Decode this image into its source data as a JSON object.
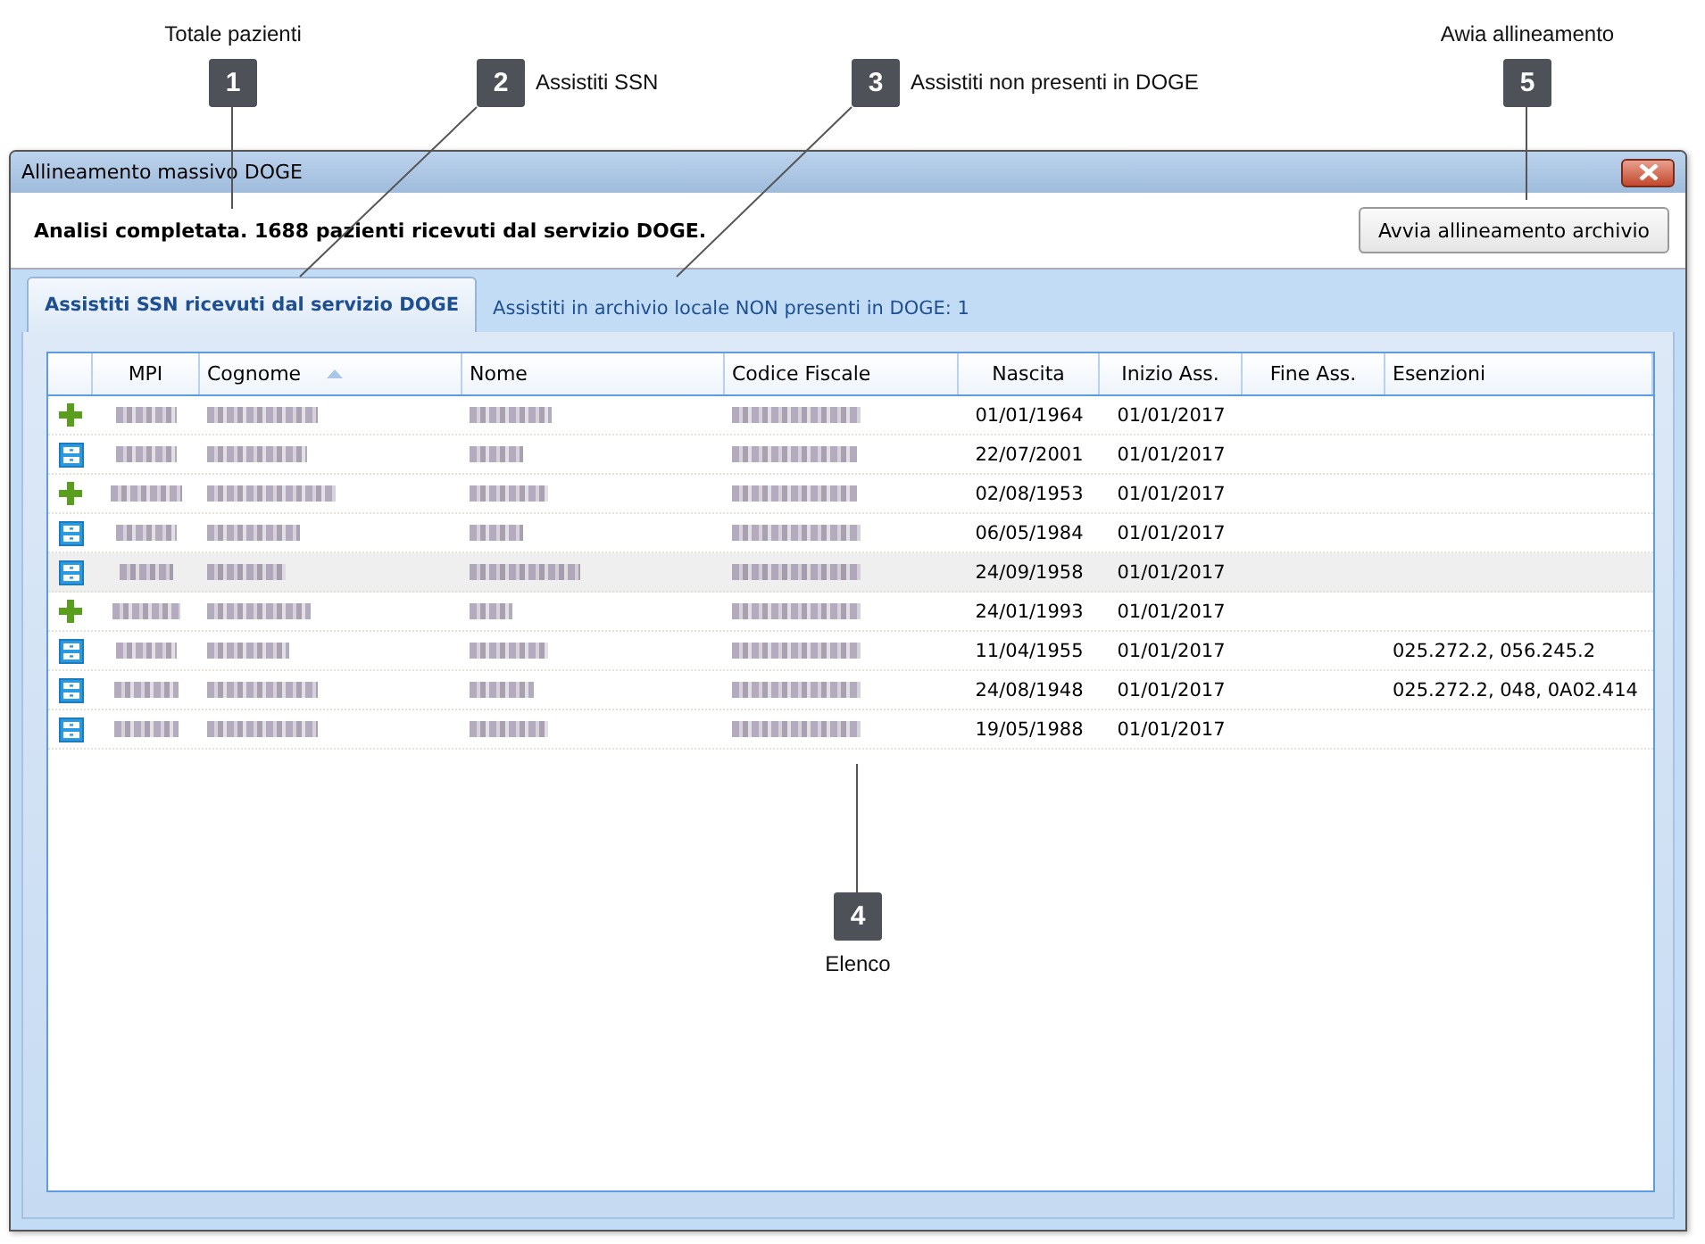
{
  "callouts": [
    {
      "number": "1",
      "label": "Totale pazienti"
    },
    {
      "number": "2",
      "label": "Assistiti SSN"
    },
    {
      "number": "3",
      "label": "Assistiti non presenti in DOGE"
    },
    {
      "number": "4",
      "label": "Elenco"
    },
    {
      "number": "5",
      "label": "Awia allineamento"
    }
  ],
  "window": {
    "title": "Allineamento massivo DOGE"
  },
  "header": {
    "message": "Analisi completata. 1688 pazienti ricevuti dal servizio DOGE.",
    "button": "Avvia allineamento archivio"
  },
  "tabs": [
    {
      "label": "Assistiti SSN ricevuti dal servizio DOGE",
      "selected": true
    },
    {
      "label": "Assistiti in archivio locale NON presenti in DOGE: 1",
      "selected": false
    }
  ],
  "table": {
    "columns": [
      {
        "label": "MPI"
      },
      {
        "label": "Cognome",
        "sorted": true
      },
      {
        "label": "Nome"
      },
      {
        "label": "Codice Fiscale"
      },
      {
        "label": "Nascita"
      },
      {
        "label": "Inizio Ass."
      },
      {
        "label": "Fine Ass."
      },
      {
        "label": "Esenzioni"
      }
    ],
    "rows": [
      {
        "kind": "add",
        "selected": false,
        "nascita": "01/01/1964",
        "inizio": "01/01/2017"
      },
      {
        "kind": "record",
        "selected": false,
        "nascita": "22/07/2001",
        "inizio": "01/01/2017"
      },
      {
        "kind": "add",
        "selected": false,
        "nascita": "02/08/1953",
        "inizio": "01/01/2017"
      },
      {
        "kind": "record",
        "selected": false,
        "nascita": "06/05/1984",
        "inizio": "01/01/2017"
      },
      {
        "kind": "record",
        "selected": true,
        "nascita": "24/09/1958",
        "inizio": "01/01/2017"
      },
      {
        "kind": "add",
        "selected": false,
        "nascita": "24/01/1993",
        "inizio": "01/01/2017"
      },
      {
        "kind": "record",
        "selected": false,
        "nascita": "11/04/1955",
        "inizio": "01/01/2017",
        "esenzioni": "025.272.2, 056.245.2"
      },
      {
        "kind": "record",
        "selected": false,
        "nascita": "24/08/1948",
        "inizio": "01/01/2017",
        "esenzioni": "025.272.2, 048, 0A02.414"
      },
      {
        "kind": "record",
        "selected": false,
        "nascita": "19/05/1988",
        "inizio": "01/01/2017"
      }
    ]
  }
}
